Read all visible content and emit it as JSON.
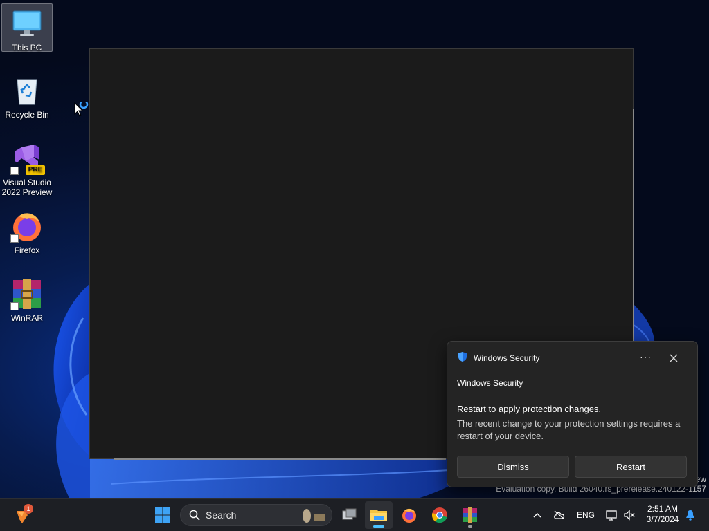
{
  "desktop": {
    "icons": [
      {
        "label": "This PC",
        "icon": "computer-monitor-icon"
      },
      {
        "label": "Recycle Bin",
        "icon": "recycle-bin-icon"
      },
      {
        "label": "Visual Studio\n2022 Preview",
        "line1": "Visual Studio",
        "line2": "2022 Preview",
        "badge": "PRE",
        "icon": "visual-studio-icon"
      },
      {
        "label": "Firefox",
        "icon": "firefox-icon"
      },
      {
        "label": "WinRAR",
        "icon": "winrar-icon"
      }
    ]
  },
  "watermark": {
    "line1": "ew",
    "line2": "Evaluation copy. Build 26040.rs_prerelease.240122-1157"
  },
  "toast": {
    "app_name": "Windows Security",
    "more_label": "···",
    "source": "Windows Security",
    "headline": "Restart to apply protection changes.",
    "body": "The recent change to your protection settings requires a restart of your device.",
    "dismiss_label": "Dismiss",
    "restart_label": "Restart"
  },
  "taskbar": {
    "notification_badge": "1",
    "search_placeholder": "Search",
    "apps": [
      "start-icon",
      "task-view-icon",
      "file-explorer-icon",
      "firefox-icon",
      "chrome-icon",
      "winrar-icon"
    ],
    "tray": {
      "language": "ENG",
      "time": "2:51 AM",
      "date": "3/7/2024"
    }
  },
  "colors": {
    "accent": "#4cc2ff",
    "taskbar_bg": "#1d1f24",
    "toast_bg": "#242424",
    "window_bg": "#1b1b1b"
  }
}
